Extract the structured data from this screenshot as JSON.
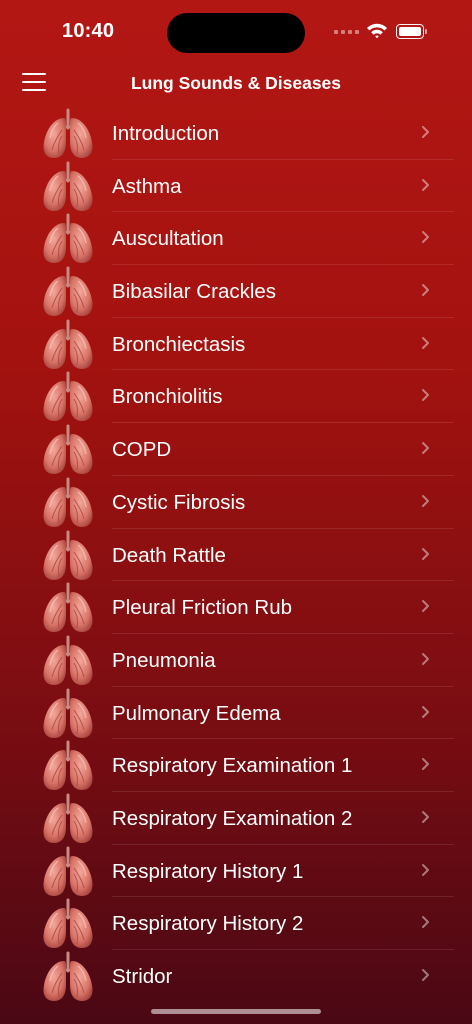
{
  "status_bar": {
    "time": "10:40"
  },
  "nav": {
    "title": "Lung Sounds & Diseases"
  },
  "items": [
    {
      "label": "Introduction"
    },
    {
      "label": "Asthma"
    },
    {
      "label": "Auscultation"
    },
    {
      "label": "Bibasilar Crackles"
    },
    {
      "label": "Bronchiectasis"
    },
    {
      "label": "Bronchiolitis"
    },
    {
      "label": "COPD"
    },
    {
      "label": "Cystic Fibrosis"
    },
    {
      "label": "Death Rattle"
    },
    {
      "label": "Pleural Friction Rub"
    },
    {
      "label": "Pneumonia"
    },
    {
      "label": "Pulmonary Edema"
    },
    {
      "label": "Respiratory Examination 1"
    },
    {
      "label": "Respiratory Examination 2"
    },
    {
      "label": "Respiratory History 1"
    },
    {
      "label": "Respiratory History 2"
    },
    {
      "label": "Stridor"
    }
  ],
  "icons": {
    "menu": "hamburger-menu-icon",
    "row": "lungs-icon",
    "chevron": "chevron-right-icon",
    "wifi": "wifi-icon",
    "battery": "battery-icon"
  },
  "colors": {
    "background_top": "#b31714",
    "background_bottom": "#4a0814",
    "lung": "#e08a80",
    "text": "#ffffff"
  }
}
